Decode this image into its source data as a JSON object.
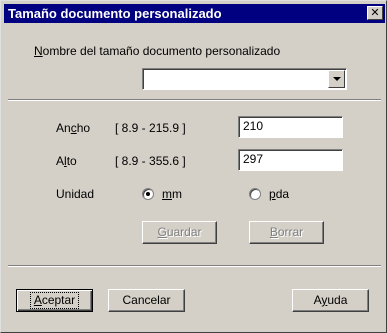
{
  "window": {
    "title": "Tamaño documento personalizado",
    "close_glyph": "✕"
  },
  "name_section": {
    "label_prefix": "N",
    "label_rest": "ombre del tamaño documento personalizado",
    "selected_value": ""
  },
  "width": {
    "label_pre": "An",
    "label_u": "c",
    "label_post": "ho",
    "range": "[   8.9  -  215.9  ]",
    "value": "210"
  },
  "height": {
    "label_pre": "A",
    "label_u": "l",
    "label_post": "to",
    "range": "[   8.9  -  355.6  ]",
    "value": "297"
  },
  "unit": {
    "label": "Unidad",
    "options": [
      {
        "u": "m",
        "rest": "m",
        "checked": true
      },
      {
        "u": "p",
        "rest": "da",
        "checked": false
      }
    ]
  },
  "actions": {
    "save_u": "G",
    "save_rest": "uardar",
    "delete_u": "B",
    "delete_rest": "orrar"
  },
  "footer": {
    "accept_u": "A",
    "accept_rest": "ceptar",
    "cancel": "Cancelar",
    "help_pre": "A",
    "help_u": "y",
    "help_post": "uda"
  },
  "icons": {
    "close": "close-icon",
    "dropdown": "chevron-down-icon"
  }
}
